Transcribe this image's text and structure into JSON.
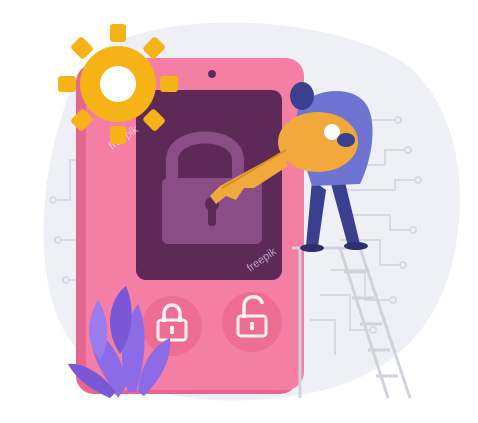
{
  "watermark": {
    "text": "freepik"
  },
  "colors": {
    "background": "#ffffff",
    "blob": "#eef0f5",
    "circuit": "#d6dae3",
    "phone_body": "#f47ea4",
    "phone_edge": "#e56691",
    "screen": "#5d2a58",
    "padlock": "#8a4d85",
    "button": "#ee6d93",
    "gear": "#f5b316",
    "key": "#f0a93a",
    "person_shirt": "#6f73d2",
    "person_pants": "#3b3f8f",
    "plant": "#8d6be6",
    "ladder": "#cfd3dc"
  },
  "icons": {
    "gear": "gear-icon",
    "key": "key-icon",
    "screen_lock": "locked-padlock-icon",
    "button_left": "locked-padlock-icon",
    "button_right": "unlocked-padlock-icon",
    "plant": "plant-icon",
    "ladder": "ladder-icon",
    "person": "person-icon",
    "circuit": "circuit-lines-icon"
  }
}
